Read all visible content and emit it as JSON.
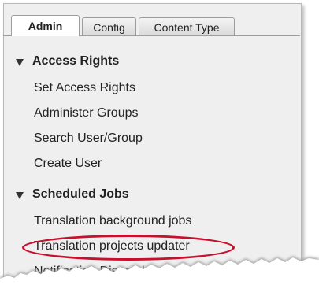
{
  "tabs": [
    {
      "label": "Admin",
      "active": true
    },
    {
      "label": "Config",
      "active": false
    },
    {
      "label": "Content Type",
      "active": false
    }
  ],
  "sections": [
    {
      "title": "Access Rights",
      "items": [
        "Set Access Rights",
        "Administer Groups",
        "Search User/Group",
        "Create User"
      ]
    },
    {
      "title": "Scheduled Jobs",
      "items": [
        "Translation background jobs",
        "Translation projects updater",
        "Notification Dispatcher"
      ]
    }
  ],
  "highlighted_item": "Translation projects updater",
  "colors": {
    "panel_background": "#efefef",
    "highlight": "#c8102e",
    "text": "#222222"
  }
}
